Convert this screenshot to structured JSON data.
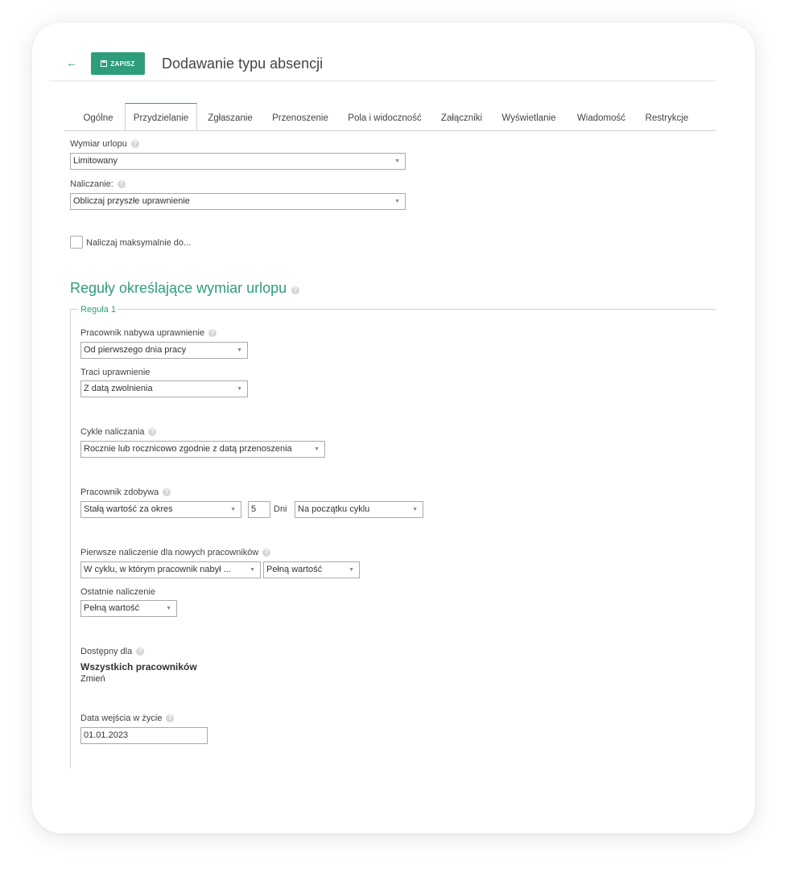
{
  "header": {
    "back_icon": "arrow-left-icon",
    "save_label": "ZAPISZ",
    "save_icon": "floppy-disk-icon",
    "title": "Dodawanie typu absencji"
  },
  "tabs": [
    {
      "label": "Ogólne",
      "active": false
    },
    {
      "label": "Przydzielanie",
      "active": true
    },
    {
      "label": "Zgłaszanie",
      "active": false
    },
    {
      "label": "Przenoszenie",
      "active": false
    },
    {
      "label": "Pola i widoczność",
      "active": false
    },
    {
      "label": "Załączniki",
      "active": false
    },
    {
      "label": "Wyświetlanie",
      "active": false
    },
    {
      "label": "Wiadomość",
      "active": false
    },
    {
      "label": "Restrykcje",
      "active": false
    }
  ],
  "form": {
    "wymiar_label": "Wymiar urlopu",
    "wymiar_value": "Limitowany",
    "naliczanie_label": "Naliczanie:",
    "naliczanie_value": "Obliczaj przyszłe uprawnienie",
    "max_checkbox_label": "Naliczaj maksymalnie do...",
    "max_checkbox_checked": false
  },
  "rules": {
    "section_title": "Reguły określające wymiar urlopu",
    "legend": "Reguła 1",
    "nabywa_label": "Pracownik nabywa uprawnienie",
    "nabywa_value": "Od pierwszego dnia pracy",
    "traci_label": "Traci uprawnienie",
    "traci_value": "Z datą zwolnienia",
    "cykle_label": "Cykle naliczania",
    "cykle_value": "Rocznie lub rocznicowo zgodnie z datą przenoszenia",
    "zdobywa_label": "Pracownik zdobywa",
    "zdobywa_value": "Stałą wartość za okres",
    "zdobywa_amount": "5",
    "zdobywa_unit": "Dni",
    "zdobywa_timing": "Na początku cyklu",
    "pierwsze_label": "Pierwsze naliczenie dla nowych pracowników",
    "pierwsze_value": "W cyklu, w którym pracownik nabył ...",
    "pierwsze_amount": "Pełną wartość",
    "ostatnie_label": "Ostatnie naliczenie",
    "ostatnie_value": "Pełną wartość",
    "dostepny_label": "Dostępny dla",
    "dostepny_value": "Wszystkich pracowników",
    "zmien_label": "Zmień",
    "data_label": "Data wejścia w życie",
    "data_value": "01.01.2023"
  },
  "colors": {
    "accent": "#2e9d7c",
    "border": "#aaaaaa",
    "help_icon": "#d6d6d6"
  },
  "icons": {
    "help": "help-circle-icon",
    "caret": "caret-down-icon"
  }
}
